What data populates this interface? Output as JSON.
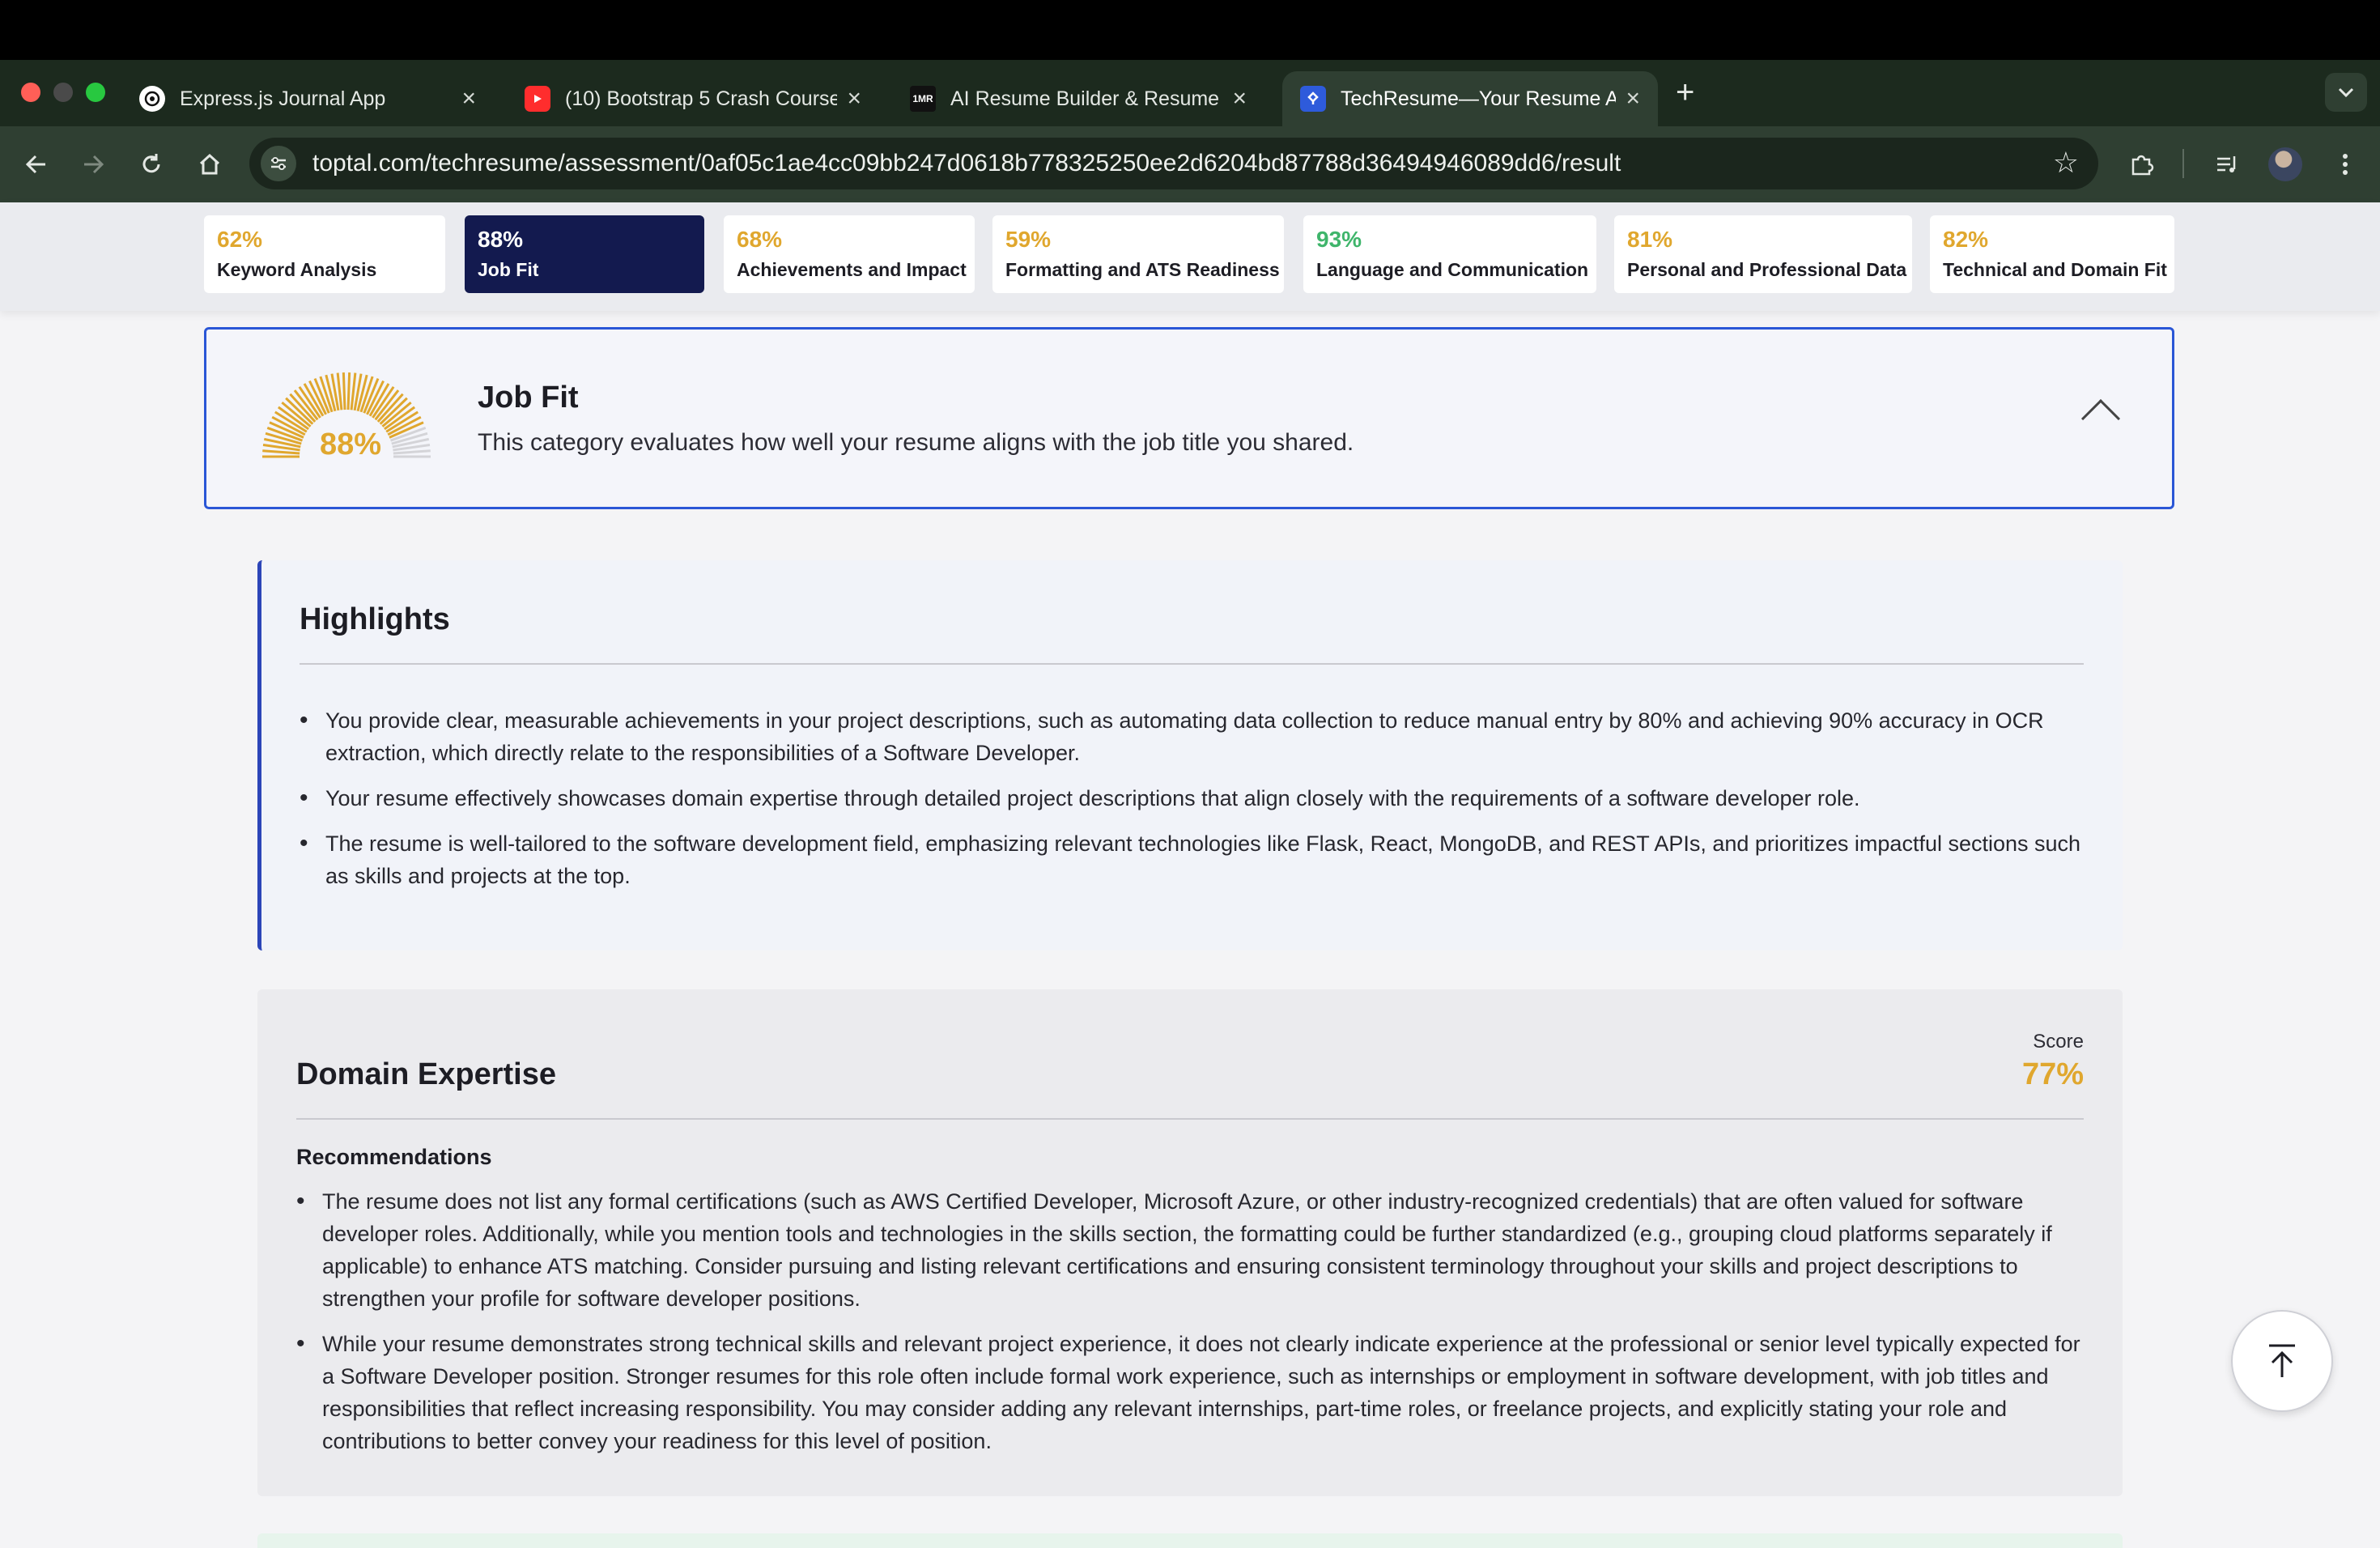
{
  "browser": {
    "tabs": [
      {
        "title": "Express.js Journal App",
        "icon": "openai-icon"
      },
      {
        "title": "(10) Bootstrap 5 Crash Course",
        "icon": "youtube-icon"
      },
      {
        "title": "AI Resume Builder & Resume",
        "icon": "1mr-icon",
        "icon_text": "1MR"
      },
      {
        "title": "TechResume—Your Resume A",
        "icon": "toptal-icon",
        "active": true
      }
    ],
    "url": "toptal.com/techresume/assessment/0af05c1ae4cc09bb247d0618b778325250ee2d6204bd87788d36494946089dd6/result"
  },
  "categories": [
    {
      "pct": "62%",
      "name": "Keyword Analysis",
      "color": "#e0a72e"
    },
    {
      "pct": "88%",
      "name": "Job Fit",
      "color": "#ffffff",
      "active": true
    },
    {
      "pct": "68%",
      "name": "Achievements and Impact",
      "color": "#e0a72e"
    },
    {
      "pct": "59%",
      "name": "Formatting and ATS Readiness",
      "color": "#e0a72e"
    },
    {
      "pct": "93%",
      "name": "Language and Communication",
      "color": "#3fb56b"
    },
    {
      "pct": "81%",
      "name": "Personal and Professional Data",
      "color": "#e0a72e"
    },
    {
      "pct": "82%",
      "name": "Technical and Domain Fit",
      "color": "#e0a72e"
    }
  ],
  "job_fit": {
    "score": "88%",
    "score_fraction": 0.88,
    "title": "Job Fit",
    "description": "This category evaluates how well your resume aligns with the job title you shared."
  },
  "highlights": {
    "title": "Highlights",
    "items": [
      "You provide clear, measurable achievements in your project descriptions, such as automating data collection to reduce manual entry by 80% and achieving 90% accuracy in OCR extraction, which directly relate to the responsibilities of a Software Developer.",
      "Your resume effectively showcases domain expertise through detailed project descriptions that align closely with the requirements of a software developer role.",
      "The resume is well-tailored to the software development field, emphasizing relevant technologies like Flask, React, MongoDB, and REST APIs, and prioritizes impactful sections such as skills and projects at the top."
    ]
  },
  "domain_expertise": {
    "title": "Domain Expertise",
    "score_label": "Score",
    "score": "77%",
    "recommendations_title": "Recommendations",
    "items": [
      "The resume does not list any formal certifications (such as AWS Certified Developer, Microsoft Azure, or other industry-recognized credentials) that are often valued for software developer roles. Additionally, while you mention tools and technologies in the skills section, the formatting could be further standardized (e.g., grouping cloud platforms separately if applicable) to enhance ATS matching. Consider pursuing and listing relevant certifications and ensuring consistent terminology throughout your skills and project descriptions to strengthen your profile for software developer positions.",
      "While your resume demonstrates strong technical skills and relevant project experience, it does not clearly indicate experience at the professional or senior level typically expected for a Software Developer position. Stronger resumes for this role often include formal work experience, such as internships or employment in software development, with job titles and responsibilities that reflect increasing responsibility. You may consider adding any relevant internships, part-time roles, or freelance projects, and explicitly stating your role and contributions to better convey your readiness for this level of position."
    ]
  },
  "colors": {
    "accent_gold": "#e0a72e",
    "accent_green": "#3fb56b",
    "active_navy": "#131a4f",
    "focus_blue": "#2a56d6"
  }
}
